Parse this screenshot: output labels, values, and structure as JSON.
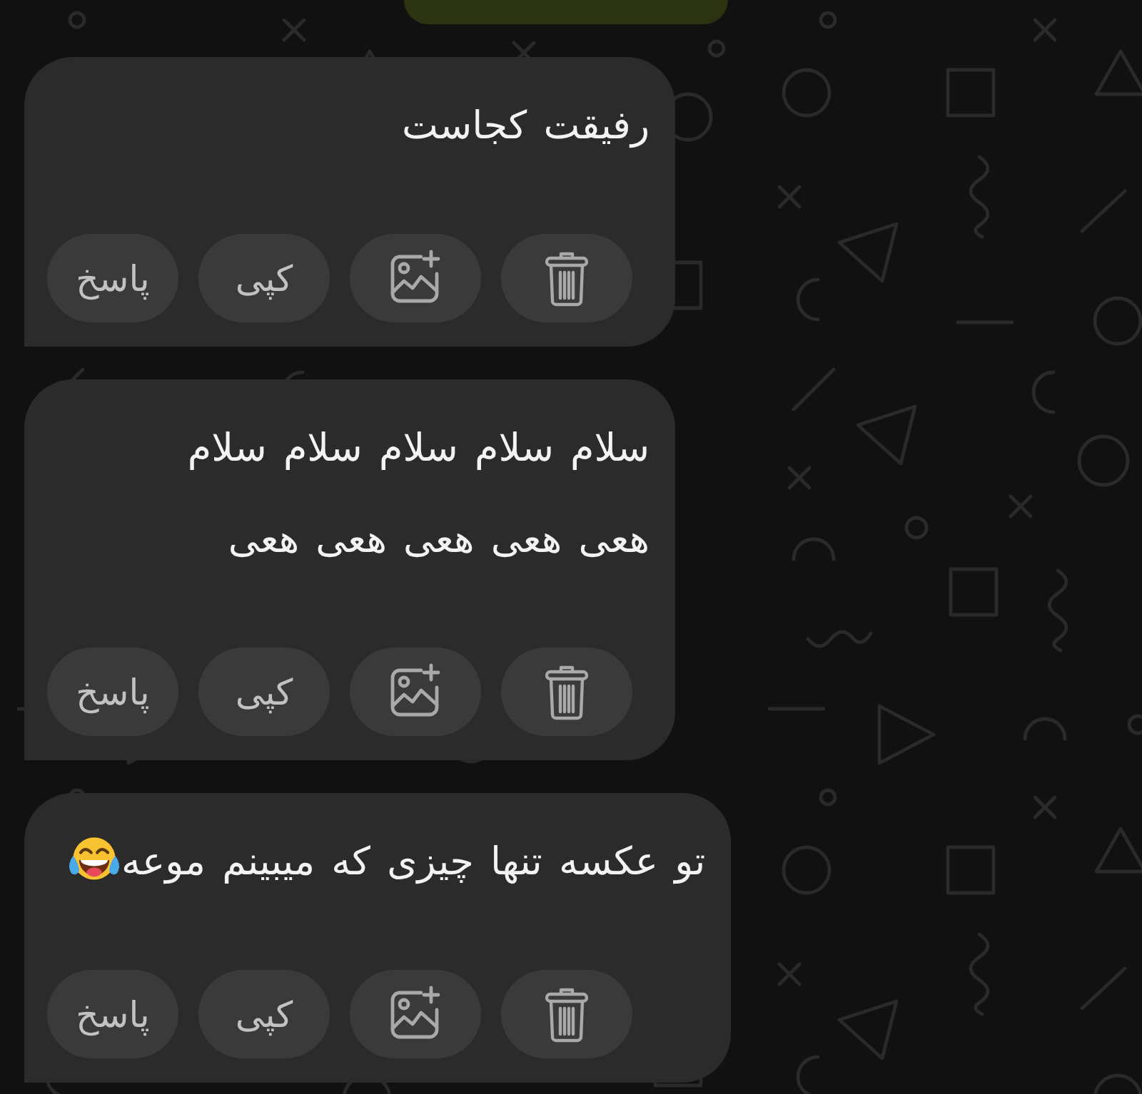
{
  "messages": [
    {
      "text": "رفیقت کجاست",
      "ends_with_emoji": false,
      "actions": [
        {
          "kind": "delete"
        },
        {
          "kind": "add-image"
        },
        {
          "kind": "copy",
          "label": "کپی"
        },
        {
          "kind": "reply",
          "label": "پاسخ"
        }
      ]
    },
    {
      "text": "سلام سلام سلام سلام سلام\nهعی هعی هعی هعی هعی",
      "ends_with_emoji": false,
      "actions": [
        {
          "kind": "delete"
        },
        {
          "kind": "add-image"
        },
        {
          "kind": "copy",
          "label": "کپی"
        },
        {
          "kind": "reply",
          "label": "پاسخ"
        }
      ]
    },
    {
      "text": "تو عکسه تنها چیزی که میبینم موعه",
      "ends_with_emoji": true,
      "actions": [
        {
          "kind": "delete"
        },
        {
          "kind": "add-image"
        },
        {
          "kind": "copy",
          "label": "کپی"
        },
        {
          "kind": "reply",
          "label": "پاسخ"
        }
      ]
    }
  ]
}
